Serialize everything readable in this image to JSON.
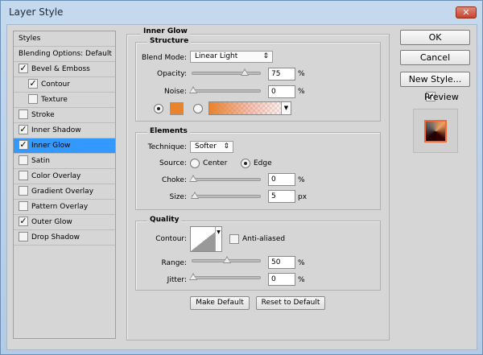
{
  "window": {
    "title": "Layer Style",
    "close_icon": "close-icon"
  },
  "sidebar": {
    "items": [
      {
        "label": "Styles",
        "has_checkbox": false,
        "checked": false,
        "indent": false,
        "selected": false
      },
      {
        "label": "Blending Options: Default",
        "has_checkbox": false,
        "checked": false,
        "indent": false,
        "selected": false
      },
      {
        "label": "Bevel & Emboss",
        "has_checkbox": true,
        "checked": true,
        "indent": false,
        "selected": false
      },
      {
        "label": "Contour",
        "has_checkbox": true,
        "checked": true,
        "indent": true,
        "selected": false
      },
      {
        "label": "Texture",
        "has_checkbox": true,
        "checked": false,
        "indent": true,
        "selected": false
      },
      {
        "label": "Stroke",
        "has_checkbox": true,
        "checked": false,
        "indent": false,
        "selected": false
      },
      {
        "label": "Inner Shadow",
        "has_checkbox": true,
        "checked": true,
        "indent": false,
        "selected": false
      },
      {
        "label": "Inner Glow",
        "has_checkbox": true,
        "checked": true,
        "indent": false,
        "selected": true
      },
      {
        "label": "Satin",
        "has_checkbox": true,
        "checked": false,
        "indent": false,
        "selected": false
      },
      {
        "label": "Color Overlay",
        "has_checkbox": true,
        "checked": false,
        "indent": false,
        "selected": false
      },
      {
        "label": "Gradient Overlay",
        "has_checkbox": true,
        "checked": false,
        "indent": false,
        "selected": false
      },
      {
        "label": "Pattern Overlay",
        "has_checkbox": true,
        "checked": false,
        "indent": false,
        "selected": false
      },
      {
        "label": "Outer Glow",
        "has_checkbox": true,
        "checked": true,
        "indent": false,
        "selected": false
      },
      {
        "label": "Drop Shadow",
        "has_checkbox": true,
        "checked": false,
        "indent": false,
        "selected": false
      }
    ]
  },
  "panel": {
    "title": "Inner Glow",
    "structure": {
      "legend": "Structure",
      "blend_mode_label": "Blend Mode:",
      "blend_mode": "Linear Light",
      "opacity_label": "Opacity:",
      "opacity": "75",
      "opacity_unit": "%",
      "noise_label": "Noise:",
      "noise": "0",
      "noise_unit": "%",
      "glow_color": "#e8832e",
      "color_selected": true
    },
    "elements": {
      "legend": "Elements",
      "technique_label": "Technique:",
      "technique": "Softer",
      "source_label": "Source:",
      "source_center": "Center",
      "source_edge": "Edge",
      "source": "Edge",
      "choke_label": "Choke:",
      "choke": "0",
      "choke_unit": "%",
      "size_label": "Size:",
      "size": "5",
      "size_unit": "px"
    },
    "quality": {
      "legend": "Quality",
      "contour_label": "Contour:",
      "anti_aliased_label": "Anti-aliased",
      "anti_aliased": false,
      "range_label": "Range:",
      "range": "50",
      "range_unit": "%",
      "jitter_label": "Jitter:",
      "jitter": "0",
      "jitter_unit": "%"
    },
    "make_default": "Make Default",
    "reset_default": "Reset to Default"
  },
  "actions": {
    "ok": "OK",
    "cancel": "Cancel",
    "new_style": "New Style...",
    "preview_label": "Preview",
    "preview_checked": true
  },
  "colors": {
    "selection": "#3399ff",
    "accent": "#e8832e"
  }
}
